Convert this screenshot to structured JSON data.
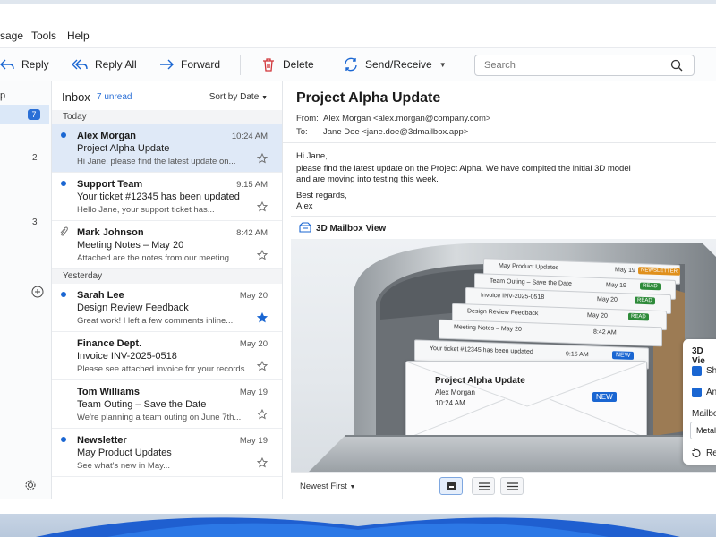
{
  "menu": {
    "message": "sage",
    "tools": "Tools",
    "help": "Help"
  },
  "toolbar": {
    "reply": "Reply",
    "reply_all": "Reply All",
    "forward": "Forward",
    "delete": "Delete",
    "send_receive": "Send/Receive",
    "search_placeholder": "Search"
  },
  "rail": {
    "partial": "p",
    "inbox_badge": "7",
    "count_2": "2",
    "count_3": "3"
  },
  "list": {
    "title": "Inbox",
    "unread": "7 unread",
    "sort": "Sort by Date",
    "group_today": "Today",
    "group_yesterday": "Yesterday",
    "messages": [
      {
        "from": "Alex Morgan",
        "subject": "Project Alpha Update",
        "preview": "Hi Jane, please find the latest update on...",
        "date": "10:24 AM"
      },
      {
        "from": "Support Team",
        "subject": "Your ticket #12345 has been updated",
        "preview": "Hello Jane, your support ticket has...",
        "date": "9:15 AM"
      },
      {
        "from": "Mark Johnson",
        "subject": "Meeting Notes – May 20",
        "preview": "Attached are the notes from our meeting...",
        "date": "8:42 AM"
      },
      {
        "from": "Sarah Lee",
        "subject": "Design Review Feedback",
        "preview": "Great work! I left a few comments inline...",
        "date": "May 20"
      },
      {
        "from": "Finance Dept.",
        "subject": "Invoice INV-2025-0518",
        "preview": "Please see attached invoice for your records.",
        "date": "May 20"
      },
      {
        "from": "Tom Williams",
        "subject": "Team Outing – Save the Date",
        "preview": "We're planning a team outing on June 7th...",
        "date": "May 19"
      },
      {
        "from": "Newsletter",
        "subject": "May Product Updates",
        "preview": "See what's new in May...",
        "date": "May 19"
      }
    ]
  },
  "reading": {
    "subject": "Project Alpha Update",
    "from_label": "From:",
    "from_value": "Alex Morgan <alex.morgan@company.com>",
    "to_label": "To:",
    "to_value": "Jane Doe <jane.doe@3dmailbox.app>",
    "body": [
      "Hi Jane,",
      "please find the latest update on the Project Alpha. We have complted the initial 3D model",
      "and are moving into testing this week.",
      "Best regards,",
      "Alex"
    ],
    "view_title": "3D Mailbox View",
    "sort_label": "Newest First"
  },
  "scene": {
    "cards": [
      {
        "subject": "May Product Updates",
        "date": "May 19",
        "badge": "NEWSLETTER"
      },
      {
        "subject": "Team Outing – Save the Date",
        "date": "May 19",
        "badge": "READ"
      },
      {
        "subject": "Invoice INV-2025-0518",
        "date": "May 20",
        "badge": "READ"
      },
      {
        "subject": "Design Review Feedback",
        "date": "May 20",
        "badge": "READ"
      },
      {
        "subject": "Meeting Notes – May 20",
        "date": "8:42 AM",
        "badge": ""
      },
      {
        "subject": "Your ticket #12345 has been updated",
        "date": "9:15 AM",
        "badge": "NEW"
      }
    ],
    "front": {
      "subject": "Project Alpha Update",
      "from": "Alex Morgan",
      "time": "10:24 AM",
      "badge": "NEW"
    }
  },
  "options": {
    "title": "3D Vie",
    "opt1": "Sh",
    "opt2": "An",
    "mailbox_label": "Mailbo",
    "material": "Metal",
    "reset": "Re"
  },
  "colors": {
    "accent": "#1a66d2",
    "selected_row": "#dfe9f7",
    "read_badge": "#2e8b3a",
    "new_badge": "#1a66d2",
    "newsletter_badge": "#e0901c"
  }
}
